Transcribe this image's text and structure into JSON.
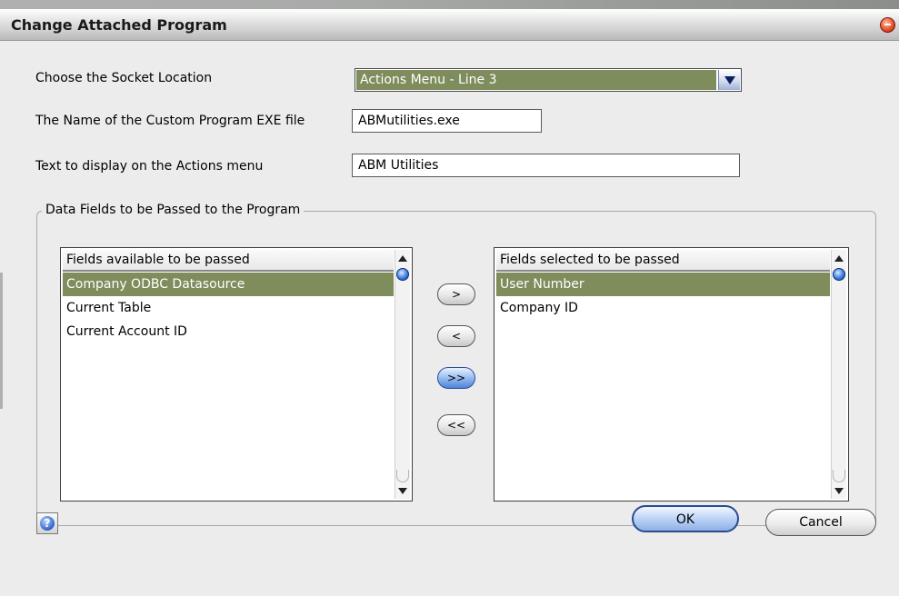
{
  "window": {
    "title": "Change Attached Program"
  },
  "form": {
    "socket_label": "Choose the Socket Location",
    "socket_value": "Actions Menu - Line 3",
    "exe_label": "The Name of the Custom Program EXE file",
    "exe_value": "ABMutilities.exe",
    "menu_text_label": "Text to display on the Actions menu",
    "menu_text_value": "ABM Utilities"
  },
  "group": {
    "title": "Data Fields to be Passed to the Program",
    "available": {
      "header": "Fields available to be passed",
      "items": [
        "Company ODBC Datasource",
        "Current Table",
        "Current Account ID"
      ],
      "selected_index": 0
    },
    "selected": {
      "header": "Fields selected to be passed",
      "items": [
        "User Number",
        "Company ID"
      ],
      "selected_index": 0
    },
    "buttons": {
      "add": ">",
      "remove": "<",
      "add_all": ">>",
      "remove_all": "<<"
    }
  },
  "footer": {
    "ok": "OK",
    "cancel": "Cancel",
    "help_glyph": "?"
  },
  "colors": {
    "selection": "#7f8c5c",
    "accent": "#3f7fe0"
  }
}
